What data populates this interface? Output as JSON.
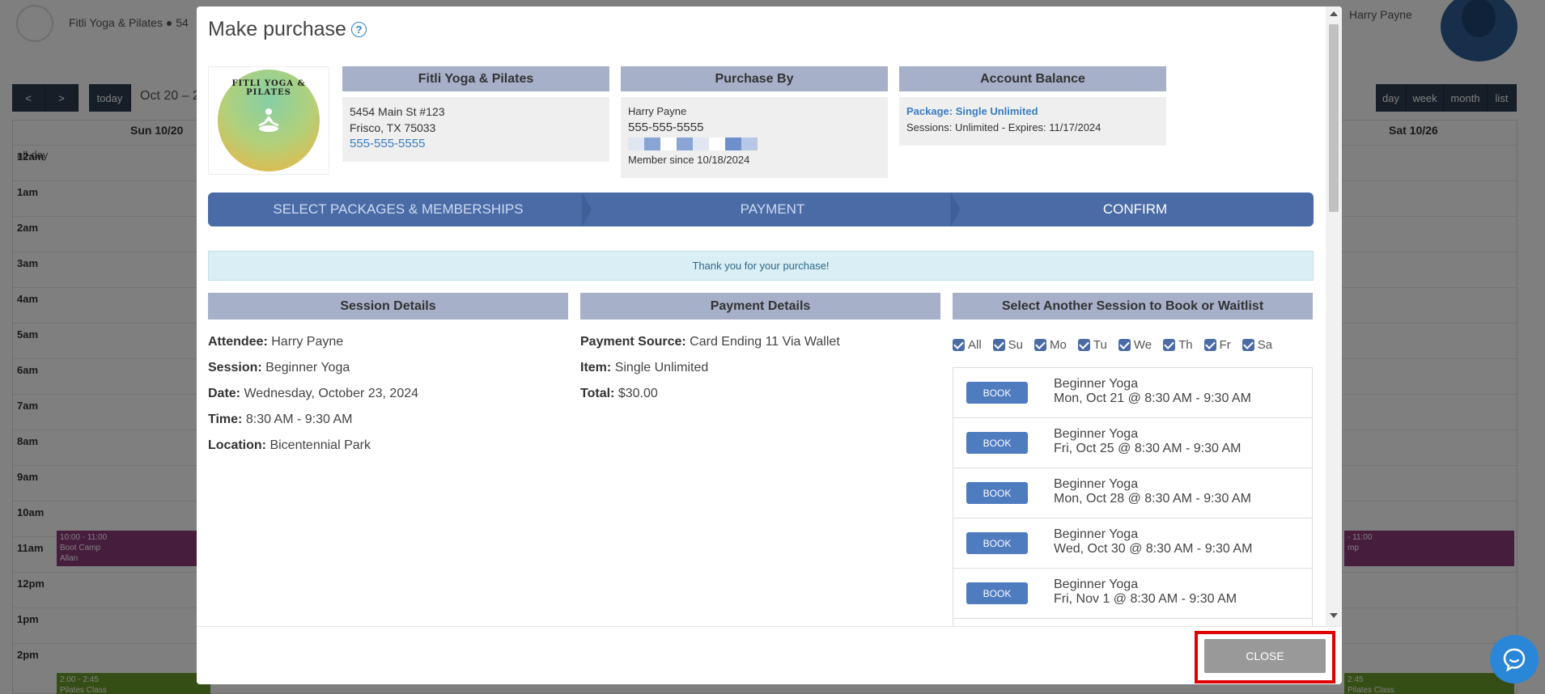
{
  "background": {
    "brand": "Fitli Yoga & Pilates  ●  54",
    "user": "Harry Payne",
    "toolbar": {
      "prev": "<",
      "next": ">",
      "today": "today",
      "range": "Oct 20 – 2"
    },
    "views": [
      "day",
      "week",
      "month",
      "list"
    ],
    "day_headers": [
      "Sun 10/20",
      "Sat 10/26"
    ],
    "allday_label": "all-day",
    "hours": [
      "12am",
      "1am",
      "2am",
      "3am",
      "4am",
      "5am",
      "6am",
      "7am",
      "8am",
      "9am",
      "10am",
      "11am",
      "12pm",
      "1pm",
      "2pm"
    ],
    "events": {
      "bootcamp_left": {
        "time": "10:00 - 11:00",
        "name": "Boot Camp",
        "staff": "Allan"
      },
      "bootcamp_right": {
        "time": "- 11:00",
        "name": "mp"
      },
      "pilates_left": {
        "time": "2:00 - 2:45",
        "name": "Pilates Class"
      },
      "pilates_right": {
        "time": "2:45",
        "name": "Pilates Class"
      },
      "pilates_mid": "Pilates Class"
    }
  },
  "modal": {
    "title": "Make purchase",
    "help_icon": "?",
    "logo_text": "FITLI YOGA & PILATES",
    "studio": {
      "header": "Fitli Yoga & Pilates",
      "address1": "5454 Main St #123",
      "address2": "Frisco, TX 75033",
      "phone": "555-555-5555"
    },
    "purchase_by": {
      "header": "Purchase By",
      "name": "Harry Payne",
      "phone": "555-555-5555",
      "member_since": "Member since 10/18/2024"
    },
    "account_balance": {
      "header": "Account Balance",
      "package": "Package: Single Unlimited",
      "sessions": "Sessions: Unlimited -  Expires: 11/17/2024"
    },
    "steps": [
      "SELECT PACKAGES & MEMBERSHIPS",
      "PAYMENT",
      "CONFIRM"
    ],
    "alert": "Thank you for your purchase!",
    "session_details": {
      "header": "Session Details",
      "attendee_label": "Attendee:",
      "attendee": "Harry Payne",
      "session_label": "Session:",
      "session": "Beginner Yoga",
      "date_label": "Date:",
      "date": "Wednesday, October 23, 2024",
      "time_label": "Time:",
      "time": "8:30 AM - 9:30 AM",
      "location_label": "Location:",
      "location": "Bicentennial Park"
    },
    "payment_details": {
      "header": "Payment Details",
      "source_label": "Payment Source:",
      "source": "Card Ending 11 Via Wallet",
      "item_label": "Item:",
      "item": "Single Unlimited",
      "total_label": "Total:",
      "total": "$30.00"
    },
    "another_session": {
      "header": "Select Another Session to Book or Waitlist",
      "filters": [
        "All",
        "Su",
        "Mo",
        "Tu",
        "We",
        "Th",
        "Fr",
        "Sa"
      ],
      "book_label": "BOOK",
      "sessions": [
        {
          "name": "Beginner Yoga",
          "time": "Mon, Oct 21 @ 8:30 AM - 9:30 AM"
        },
        {
          "name": "Beginner Yoga",
          "time": "Fri, Oct 25 @ 8:30 AM - 9:30 AM"
        },
        {
          "name": "Beginner Yoga",
          "time": "Mon, Oct 28 @ 8:30 AM - 9:30 AM"
        },
        {
          "name": "Beginner Yoga",
          "time": "Wed, Oct 30 @ 8:30 AM - 9:30 AM"
        },
        {
          "name": "Beginner Yoga",
          "time": "Fri, Nov 1 @ 8:30 AM - 9:30 AM"
        }
      ]
    },
    "close_label": "CLOSE"
  },
  "colors": {
    "accent": "#4a6ba6",
    "header_bg": "#a6b0c8",
    "highlight": "#e00000"
  }
}
